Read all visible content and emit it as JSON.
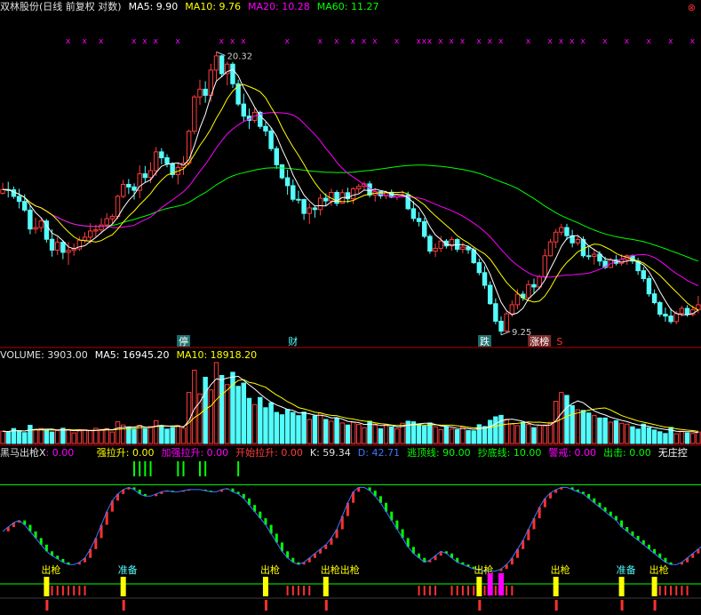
{
  "header": {
    "title": "双林股份(日线 前复权 对数)",
    "ma5": "MA5: 9.90",
    "ma10": "MA10: 9.76",
    "ma20": "MA20: 10.28",
    "ma60": "MA60: 11.27",
    "close_glyph": "⊗"
  },
  "volume_header": {
    "volume": "VOLUME: 3903.00",
    "ma5": "MA5: 16945.20",
    "ma10": "MA10: 18918.20"
  },
  "indicator_header": {
    "name": "黑马出枪X",
    "v1": ": 0.00",
    "v2": "强拉升: 0.00",
    "v3": "加强拉升: 0.00",
    "v4": "开始拉升: 0.00",
    "k": "K: 59.34",
    "d": "D: 42.71",
    "escape": "逃顶线: 90.00",
    "bottom": "抄底线: 10.00",
    "warn": "警戒: 0.00",
    "strike": "出击: 0.00",
    "nozhuang": "无庄控"
  },
  "colors": {
    "up": "#ff3c3c",
    "down": "#54fcfc",
    "ma5": "#ffffff",
    "ma10": "#ffff00",
    "ma20": "#ff00ff",
    "ma60": "#00ff00",
    "panel_border": "#b00000",
    "kline": "#3c78ff"
  },
  "chart_data": {
    "type": "candlestick",
    "title": "双林股份(日线 前复权 对数)",
    "price_range": [
      9.25,
      20.32
    ],
    "annotations": {
      "high": {
        "label": "20.32",
        "value": 20.32
      },
      "low": {
        "label": "9.25",
        "value": 9.25
      },
      "tags": [
        "停",
        "财",
        "跌",
        "涨榜",
        "S"
      ]
    },
    "ohlc": [
      [
        13.72,
        14.12,
        13.66,
        13.86
      ],
      [
        13.86,
        14.16,
        13.56,
        13.85
      ],
      [
        13.85,
        13.98,
        13.51,
        13.6
      ],
      [
        13.6,
        13.89,
        13.15,
        13.41
      ],
      [
        13.41,
        13.68,
        13.02,
        13.09
      ],
      [
        13.09,
        13.25,
        12.24,
        12.42
      ],
      [
        12.42,
        12.82,
        12.26,
        12.47
      ],
      [
        12.47,
        12.81,
        12.32,
        12.7
      ],
      [
        12.7,
        12.77,
        11.96,
        12.07
      ],
      [
        12.07,
        12.41,
        11.5,
        11.71
      ],
      [
        11.71,
        12.15,
        11.55,
        11.97
      ],
      [
        11.97,
        12.04,
        11.42,
        11.64
      ],
      [
        11.64,
        11.98,
        11.24,
        11.7
      ],
      [
        11.7,
        11.93,
        11.53,
        11.75
      ],
      [
        11.75,
        12.16,
        11.68,
        12.04
      ],
      [
        12.04,
        12.31,
        11.94,
        12.14
      ],
      [
        12.14,
        12.62,
        11.93,
        12.35
      ],
      [
        12.35,
        12.57,
        12.13,
        12.39
      ],
      [
        12.39,
        12.8,
        12.26,
        12.56
      ],
      [
        12.56,
        12.98,
        12.45,
        12.78
      ],
      [
        12.78,
        12.95,
        12.58,
        12.86
      ],
      [
        12.86,
        13.66,
        12.77,
        13.6
      ],
      [
        13.6,
        14.24,
        13.53,
        14.06
      ],
      [
        14.06,
        14.27,
        13.69,
        13.96
      ],
      [
        13.96,
        14.1,
        13.48,
        13.83
      ],
      [
        13.83,
        14.82,
        13.53,
        14.48
      ],
      [
        14.48,
        14.8,
        14.14,
        14.33
      ],
      [
        14.33,
        14.95,
        14.11,
        14.61
      ],
      [
        14.61,
        15.6,
        14.39,
        15.39
      ],
      [
        15.39,
        15.55,
        14.87,
        15.14
      ],
      [
        15.14,
        15.29,
        14.74,
        14.9
      ],
      [
        14.9,
        14.95,
        14.31,
        14.45
      ],
      [
        14.45,
        14.9,
        14.06,
        14.74
      ],
      [
        14.74,
        15.21,
        14.44,
        14.92
      ],
      [
        14.92,
        16.37,
        14.81,
        16.3
      ],
      [
        16.3,
        18.03,
        16.17,
        17.93
      ],
      [
        17.93,
        18.81,
        17.54,
        18.32
      ],
      [
        18.32,
        18.73,
        17.64,
        18.01
      ],
      [
        18.01,
        19.66,
        17.69,
        19.32
      ],
      [
        19.32,
        20.32,
        18.77,
        20.1
      ],
      [
        20.1,
        20.15,
        18.94,
        19.13
      ],
      [
        19.13,
        19.79,
        18.52,
        19.64
      ],
      [
        19.64,
        19.76,
        18.38,
        18.6
      ],
      [
        18.6,
        18.81,
        17.48,
        17.58
      ],
      [
        17.58,
        18.09,
        16.73,
        17.0
      ],
      [
        17.0,
        17.36,
        16.4,
        16.8
      ],
      [
        16.8,
        17.4,
        16.68,
        17.18
      ],
      [
        17.18,
        17.26,
        16.41,
        16.52
      ],
      [
        16.52,
        16.73,
        16.08,
        16.31
      ],
      [
        16.31,
        16.46,
        15.42,
        15.53
      ],
      [
        15.53,
        15.64,
        14.68,
        14.85
      ],
      [
        14.85,
        14.86,
        14.26,
        14.32
      ],
      [
        14.32,
        14.65,
        13.66,
        14.01
      ],
      [
        14.01,
        14.26,
        13.4,
        13.49
      ],
      [
        13.49,
        13.82,
        13.33,
        13.48
      ],
      [
        13.48,
        13.51,
        12.74,
        12.97
      ],
      [
        12.97,
        13.34,
        12.6,
        13.17
      ],
      [
        13.17,
        13.27,
        12.82,
        13.11
      ],
      [
        13.11,
        13.69,
        12.9,
        13.53
      ],
      [
        13.53,
        13.71,
        13.25,
        13.43
      ],
      [
        13.43,
        13.89,
        13.24,
        13.75
      ],
      [
        13.75,
        13.84,
        13.24,
        13.34
      ],
      [
        13.34,
        13.87,
        13.32,
        13.74
      ],
      [
        13.74,
        13.93,
        13.35,
        13.51
      ],
      [
        13.51,
        13.95,
        13.31,
        13.89
      ],
      [
        13.89,
        14.08,
        13.72,
        13.98
      ],
      [
        13.98,
        14.17,
        13.82,
        14.08
      ],
      [
        14.08,
        14.19,
        13.56,
        13.65
      ],
      [
        13.65,
        13.91,
        13.4,
        13.78
      ],
      [
        13.78,
        13.8,
        13.51,
        13.62
      ],
      [
        13.62,
        13.82,
        13.5,
        13.75
      ],
      [
        13.75,
        13.86,
        13.53,
        13.57
      ],
      [
        13.57,
        13.7,
        13.46,
        13.65
      ],
      [
        13.65,
        13.82,
        13.56,
        13.66
      ],
      [
        13.66,
        13.78,
        13.09,
        13.14
      ],
      [
        13.14,
        13.42,
        12.68,
        12.79
      ],
      [
        12.79,
        13.02,
        12.51,
        12.68
      ],
      [
        12.68,
        12.81,
        12.1,
        12.17
      ],
      [
        12.17,
        12.24,
        11.59,
        11.68
      ],
      [
        11.68,
        11.93,
        11.49,
        11.77
      ],
      [
        11.77,
        12.18,
        11.65,
        12.01
      ],
      [
        12.01,
        12.08,
        11.76,
        11.85
      ],
      [
        11.85,
        12.16,
        11.69,
        12.06
      ],
      [
        12.06,
        12.11,
        11.65,
        11.74
      ],
      [
        11.74,
        11.97,
        11.61,
        11.81
      ],
      [
        11.81,
        11.87,
        11.59,
        11.72
      ],
      [
        11.72,
        11.79,
        11.27,
        11.31
      ],
      [
        11.31,
        11.44,
        10.92,
        11.0
      ],
      [
        11.0,
        11.2,
        10.52,
        10.62
      ],
      [
        10.62,
        10.74,
        10.06,
        10.09
      ],
      [
        10.09,
        10.24,
        9.53,
        9.61
      ],
      [
        9.61,
        9.74,
        9.25,
        9.35
      ],
      [
        9.35,
        9.87,
        9.31,
        9.81
      ],
      [
        9.81,
        10.18,
        9.73,
        10.06
      ],
      [
        10.06,
        10.51,
        9.94,
        10.36
      ],
      [
        10.36,
        10.45,
        10.17,
        10.26
      ],
      [
        10.26,
        10.77,
        10.16,
        10.64
      ],
      [
        10.64,
        10.82,
        10.37,
        10.57
      ],
      [
        10.57,
        10.93,
        10.5,
        10.88
      ],
      [
        10.88,
        11.75,
        10.81,
        11.53
      ],
      [
        11.53,
        12.08,
        11.5,
        11.98
      ],
      [
        11.98,
        12.42,
        11.78,
        12.31
      ],
      [
        12.31,
        12.6,
        12.2,
        12.47
      ],
      [
        12.47,
        12.6,
        12.05,
        12.19
      ],
      [
        12.19,
        12.39,
        11.8,
        11.95
      ],
      [
        11.95,
        12.18,
        11.86,
        12.06
      ],
      [
        12.06,
        12.17,
        11.46,
        11.53
      ],
      [
        11.53,
        11.81,
        11.4,
        11.51
      ],
      [
        11.51,
        11.76,
        11.25,
        11.58
      ],
      [
        11.58,
        11.68,
        11.21,
        11.36
      ],
      [
        11.36,
        11.5,
        11.11,
        11.16
      ],
      [
        11.16,
        11.46,
        11.14,
        11.4
      ],
      [
        11.4,
        11.55,
        11.22,
        11.29
      ],
      [
        11.29,
        11.58,
        11.21,
        11.41
      ],
      [
        11.41,
        11.58,
        11.24,
        11.53
      ],
      [
        11.53,
        11.57,
        11.27,
        11.36
      ],
      [
        11.36,
        11.46,
        10.93,
        11.06
      ],
      [
        11.06,
        11.17,
        10.72,
        10.82
      ],
      [
        10.82,
        10.91,
        10.29,
        10.37
      ],
      [
        10.37,
        10.5,
        10.07,
        10.12
      ],
      [
        10.12,
        10.17,
        9.73,
        9.8
      ],
      [
        9.8,
        9.98,
        9.6,
        9.75
      ],
      [
        9.75,
        9.96,
        9.54,
        9.6
      ],
      [
        9.6,
        9.89,
        9.53,
        9.82
      ],
      [
        9.82,
        10.03,
        9.74,
        9.96
      ],
      [
        9.96,
        10.05,
        9.73,
        9.79
      ],
      [
        9.79,
        10.04,
        9.74,
        9.92
      ],
      [
        9.92,
        10.31,
        9.83,
        10.06
      ]
    ],
    "volume": [
      4200,
      3900,
      5100,
      4300,
      3700,
      6200,
      4800,
      5100,
      4600,
      3900,
      4400,
      5200,
      4800,
      3600,
      4300,
      4700,
      4400,
      5200,
      4800,
      5100,
      3900,
      7400,
      6300,
      5600,
      4900,
      6200,
      5000,
      5800,
      7800,
      6100,
      4900,
      5400,
      6100,
      5200,
      17400,
      25000,
      16900,
      22600,
      18300,
      27600,
      23200,
      20100,
      24300,
      19500,
      20600,
      15400,
      13300,
      15700,
      12200,
      13900,
      10600,
      9800,
      11600,
      10600,
      9500,
      10700,
      8200,
      9400,
      10300,
      8200,
      7600,
      8600,
      7000,
      6300,
      7200,
      6500,
      5400,
      7600,
      6200,
      5000,
      6400,
      5600,
      5000,
      6900,
      7600,
      7400,
      6600,
      5900,
      7000,
      5700,
      4700,
      5800,
      4900,
      4700,
      5600,
      4400,
      4300,
      6400,
      5800,
      7900,
      9100,
      9600,
      8300,
      6600,
      6100,
      7200,
      6500,
      5400,
      6200,
      6000,
      7200,
      14400,
      17400,
      16400,
      12900,
      11500,
      11300,
      10400,
      9600,
      8700,
      8700,
      7300,
      7800,
      6900,
      6600,
      5700,
      4900,
      6600,
      5400,
      4600,
      4000,
      3400,
      5500,
      3300,
      4200,
      3600,
      3400,
      3903
    ],
    "ma_summary": {
      "MA5": 9.9,
      "MA10": 9.76,
      "MA20": 10.28,
      "MA60": 11.27
    },
    "volume_summary": {
      "VOLUME": 3903.0,
      "MA5": 16945.2,
      "MA10": 18918.2
    },
    "indicator": {
      "name": "黑马出枪X",
      "levels": {
        "逃顶线": 90,
        "抄底线": 10
      },
      "kd": {
        "K": 59.34,
        "D": 42.71
      },
      "labels": [
        {
          "text": "出枪",
          "bar": 8
        },
        {
          "text": "准备",
          "bar": 22
        },
        {
          "text": "出枪",
          "bar": 48
        },
        {
          "text": "出枪出枪",
          "bar": 59
        },
        {
          "text": "出枪",
          "bar": 87
        },
        {
          "text": "出枪",
          "bar": 101
        },
        {
          "text": "准备",
          "bar": 113
        },
        {
          "text": "出枪",
          "bar": 119
        },
        {
          "text": "出枪",
          "bar": 134
        }
      ],
      "k_values": [
        50,
        54,
        58,
        60,
        56,
        50,
        44,
        38,
        32,
        28,
        25,
        22,
        20,
        20,
        22,
        26,
        34,
        44,
        56,
        68,
        78,
        84,
        88,
        90,
        88,
        84,
        82,
        82,
        84,
        86,
        87,
        86,
        86,
        87,
        88,
        88,
        88,
        87,
        86,
        86,
        88,
        89,
        86,
        84,
        80,
        74,
        68,
        62,
        56,
        48,
        40,
        32,
        26,
        22,
        20,
        22,
        26,
        30,
        34,
        38,
        44,
        52,
        64,
        76,
        86,
        90,
        90,
        87,
        82,
        76,
        68,
        60,
        52,
        44,
        36,
        30,
        26,
        22,
        24,
        28,
        32,
        30,
        26,
        22,
        20,
        18,
        16,
        15,
        14,
        14,
        14,
        16,
        20,
        26,
        34,
        42,
        52,
        62,
        72,
        80,
        85,
        88,
        90,
        90,
        88,
        86,
        84,
        80,
        76,
        72,
        68,
        64,
        60,
        54,
        50,
        46,
        42,
        38,
        34,
        30,
        26,
        22,
        20,
        20,
        22,
        26,
        30,
        34,
        38,
        46,
        52,
        57,
        60
      ]
    }
  }
}
